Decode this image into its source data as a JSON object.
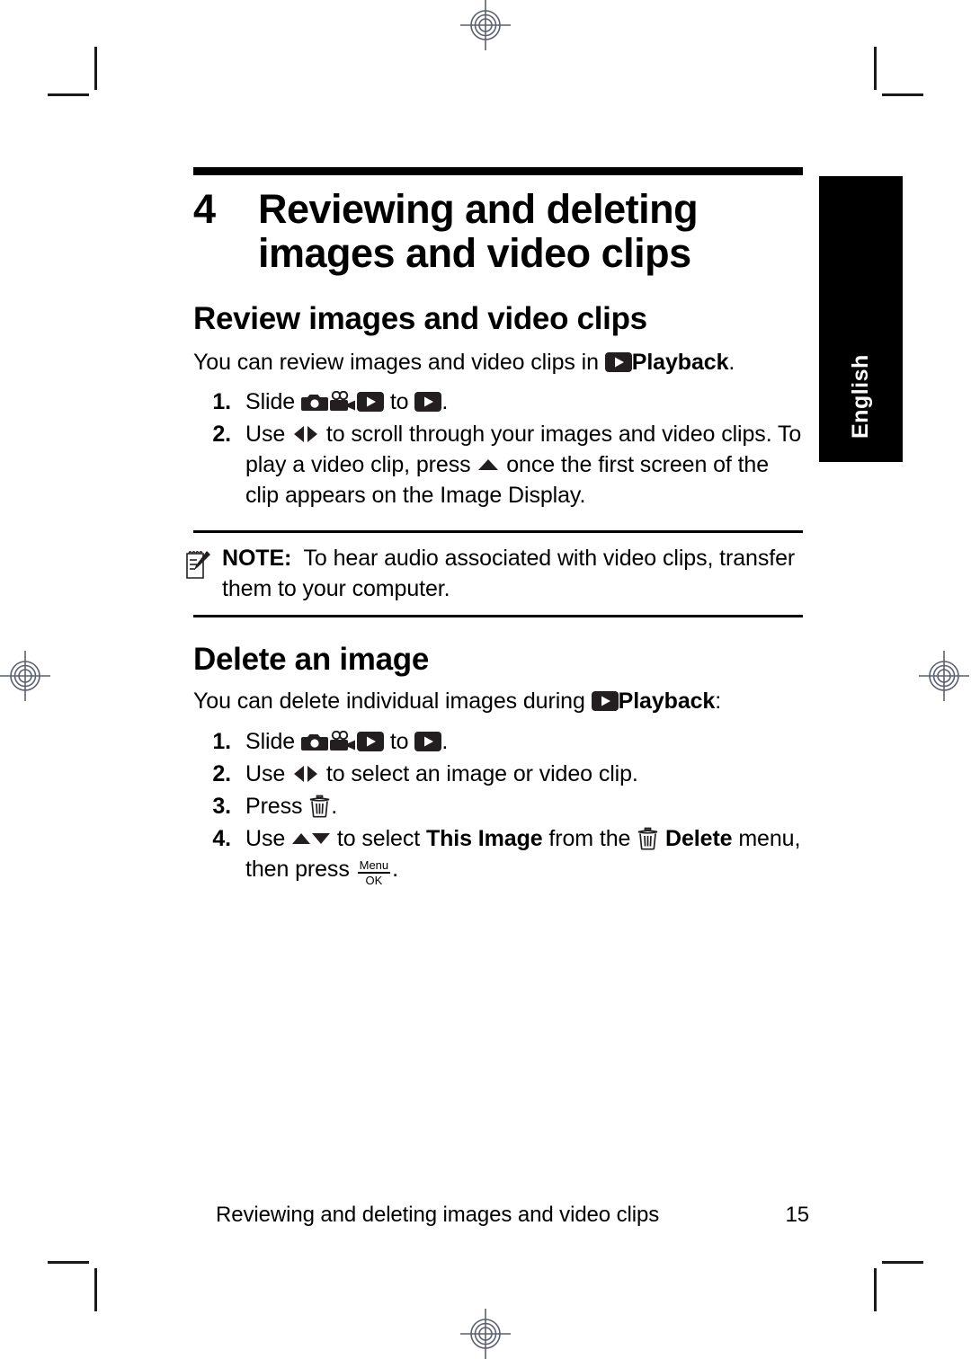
{
  "page": {
    "language_tab": "English",
    "chapter_number": "4",
    "chapter_title": "Reviewing and deleting images and video clips"
  },
  "sections": [
    {
      "heading": "Review images and video clips",
      "intro_before": "You can review images and video clips in",
      "intro_bold": "Playback",
      "intro_after": ".",
      "steps": [
        {
          "number": "1.",
          "text_a": "Slide",
          "text_b": "to",
          "text_c": "."
        },
        {
          "number": "2.",
          "text_a": "Use",
          "text_b": "to scroll through your images and video clips. To play a video clip, press",
          "text_c": "once the first screen of the clip appears on the Image Display."
        }
      ]
    },
    {
      "heading": "Delete an image",
      "intro_before": "You can delete individual images during",
      "intro_bold": "Playback",
      "intro_after": ":",
      "steps": [
        {
          "number": "1.",
          "text_a": "Slide",
          "text_b": "to",
          "text_c": "."
        },
        {
          "number": "2.",
          "text_a": "Use",
          "text_b": "to select an image or video clip.",
          "text_c": ""
        },
        {
          "number": "3.",
          "text_a": "Press",
          "text_b": ".",
          "text_c": ""
        },
        {
          "number": "4.",
          "text_a": "Use",
          "text_b": "to select",
          "text_bold_1": "This Image",
          "text_c": "from the",
          "text_bold_2": "Delete",
          "text_d": "menu, then press",
          "text_e": "."
        }
      ]
    }
  ],
  "note": {
    "label": "NOTE:",
    "text": "To hear audio associated with video clips, transfer them to your computer."
  },
  "footer": {
    "title": "Reviewing and deleting images and video clips",
    "page_number": "15"
  },
  "icons": {
    "playback": "playback-icon",
    "camera": "camera-icon",
    "video": "video-camera-icon",
    "left_right": "left-right-arrows-icon",
    "up": "up-arrow-icon",
    "up_down": "up-down-arrows-icon",
    "trash": "trash-delete-icon",
    "note": "notepad-pencil-icon",
    "menu_ok": "menu-ok-button-icon",
    "menu_ok_top": "Menu",
    "menu_ok_bottom": "OK"
  },
  "colors": {
    "ink": "#000000",
    "paper": "#ffffff",
    "registration": "#5a5f73"
  }
}
